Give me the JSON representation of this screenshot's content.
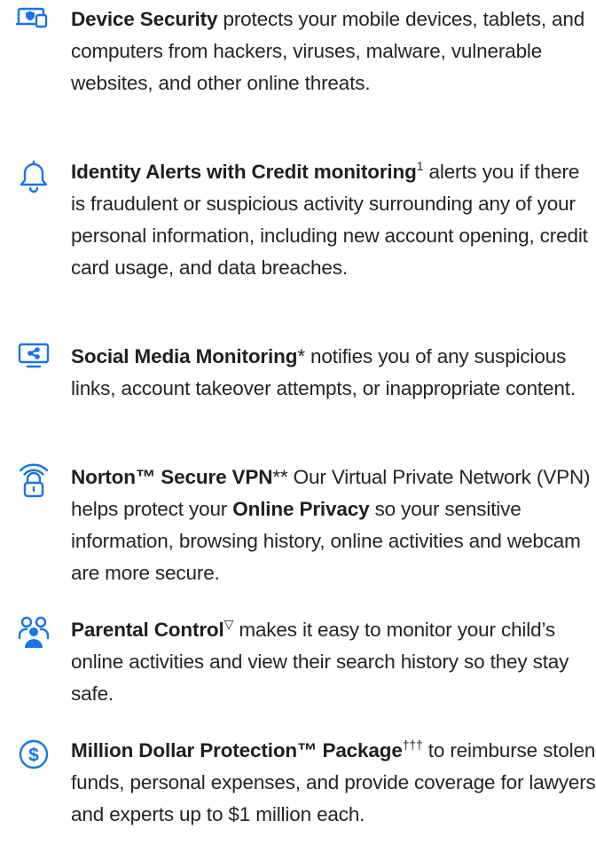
{
  "features": [
    {
      "icon": "devices-icon",
      "title": "Device Security",
      "sup": "",
      "text": " protects your mobile devices, tablets, and computers from hackers, viruses, malware, vulnerable websites, and other online threats."
    },
    {
      "icon": "bell-icon",
      "title": "Identity Alerts with Credit monitoring",
      "sup": "1",
      "text": " alerts you if there is fraudulent or suspicious activity surrounding any of your personal information, including new account opening, credit card usage, and data breaches."
    },
    {
      "icon": "share-monitor-icon",
      "title": "Social Media Monitoring",
      "sup": "",
      "text": "* notifies you of any suspicious links, account takeover attempts, or inappropriate content."
    },
    {
      "icon": "wifi-lock-icon",
      "title": "Norton™ Secure VPN",
      "sup": "",
      "text": "** Our Virtual Private Network (VPN) helps protect your ",
      "emphasis": "Online Privacy",
      "text_after": " so your sensitive information, browsing history, online activities and webcam are more secure."
    },
    {
      "icon": "family-icon",
      "title": "Parental Control",
      "sup": "▽",
      "text": " makes it easy to monitor your child’s online activities and view their search history so they stay safe."
    },
    {
      "icon": "dollar-circle-icon",
      "title": "Million Dollar Protection™ Package",
      "sup": "†††",
      "text": " to reimburse stolen funds, personal expenses, and provide coverage for lawyers and experts up to $1 million each."
    }
  ],
  "colors": {
    "accent": "#1a73e8",
    "text": "#242424"
  }
}
